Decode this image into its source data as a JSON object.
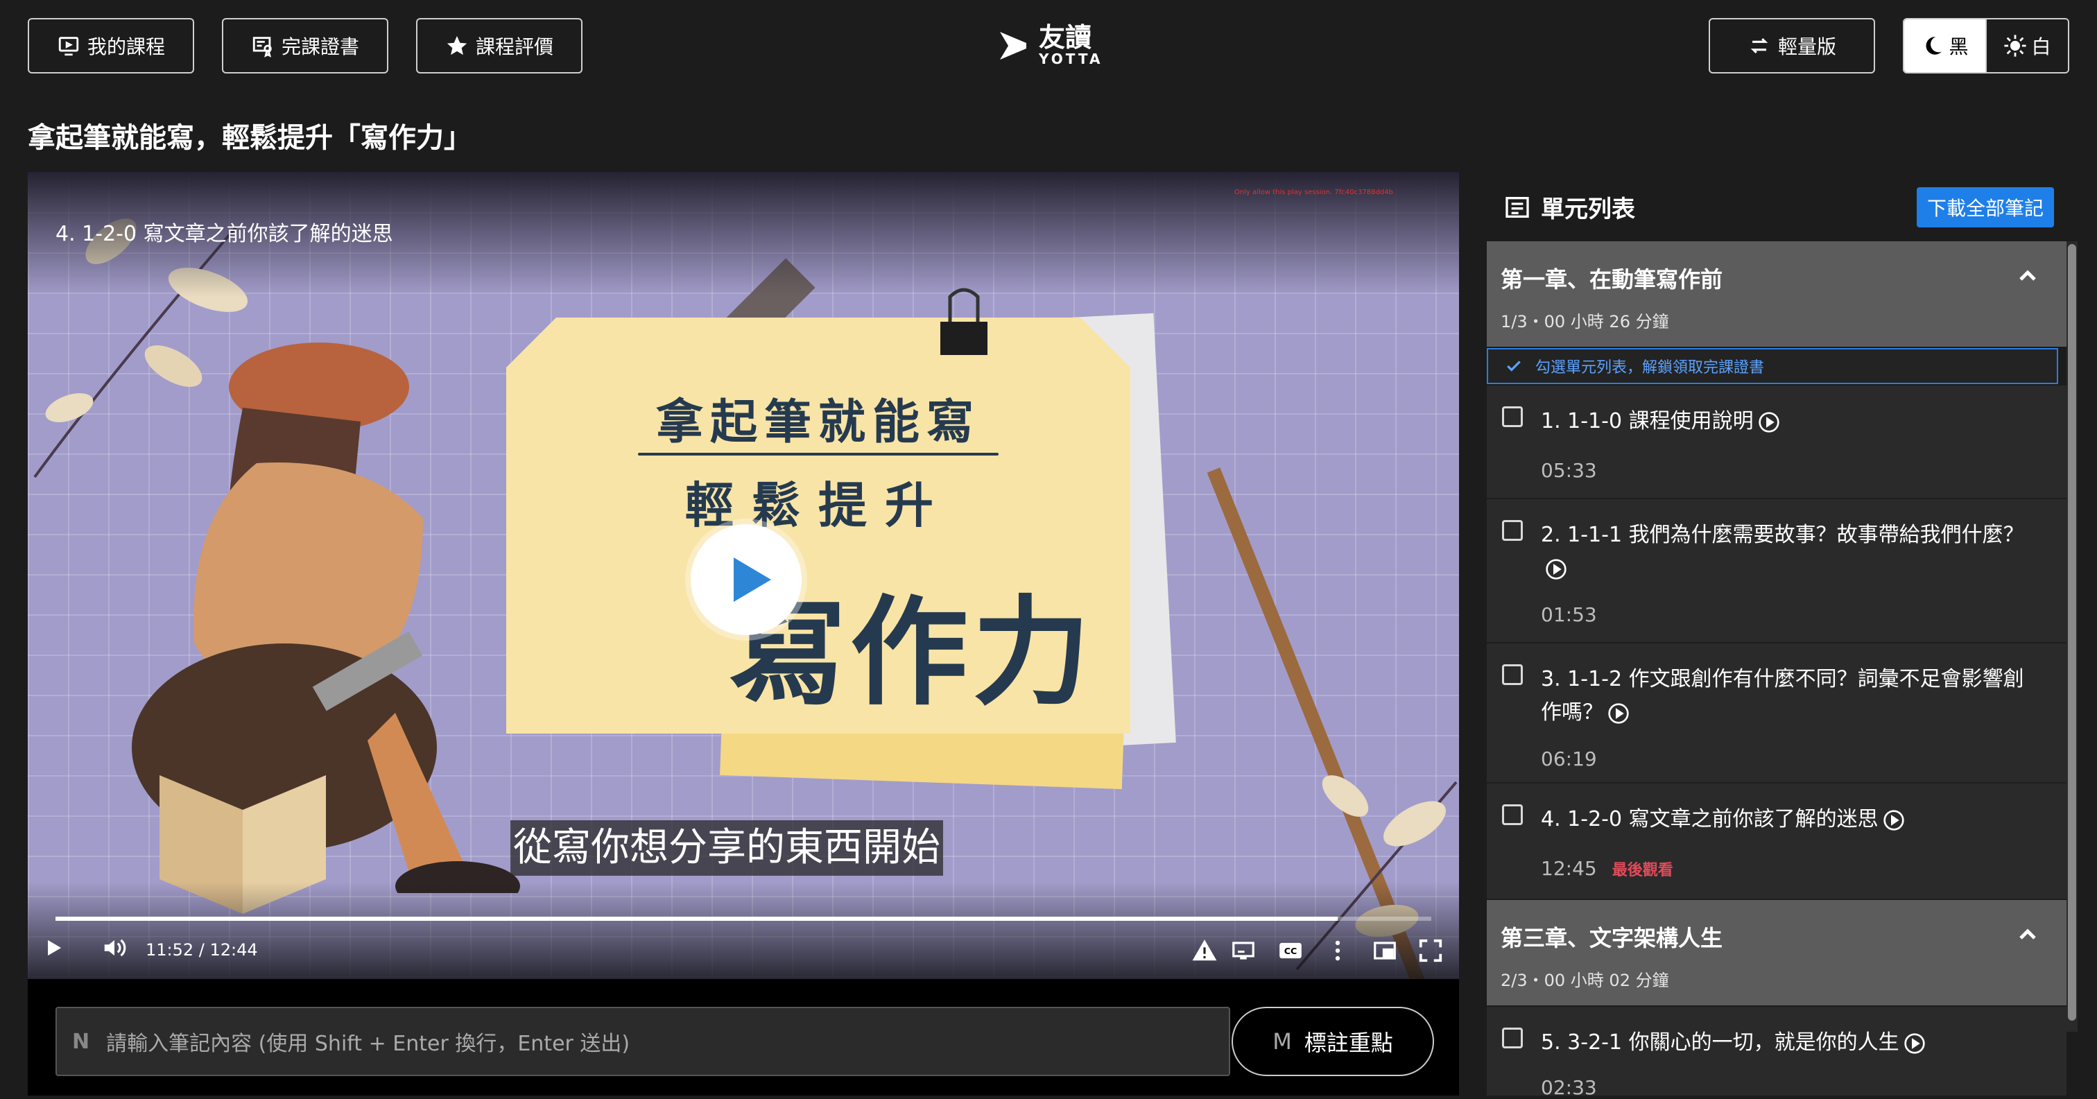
{
  "header": {
    "my_courses_label": "我的課程",
    "certificate_label": "完課證書",
    "review_label": "課程評價",
    "logo_cn": "友讀",
    "logo_en": "YOTTA",
    "lite_label": "輕量版",
    "theme_dark_label": "黑",
    "theme_light_label": "白"
  },
  "course_title": "拿起筆就能寫，輕鬆提升「寫作力」",
  "video": {
    "title": "4. 1-2-0 寫文章之前你該了解的迷思",
    "watermark": "Only allow this play session. 7fc40c3788dd4b",
    "card_line1": "拿起筆就能寫",
    "card_line2": "輕鬆提升",
    "card_line3": "寫作力",
    "subtitle": "從寫你想分享的東西開始",
    "time": "11:52 / 12:44",
    "progress": 0.932
  },
  "notes": {
    "shortcut_n": "N",
    "placeholder": "請輸入筆記內容 (使用 Shift + Enter 換行，Enter 送出)",
    "mark_shortcut": "M",
    "mark_label": "標註重點"
  },
  "sidebar": {
    "title": "單元列表",
    "download_label": "下載全部筆記",
    "hint": "勾選單元列表，解鎖領取完課證書",
    "chapters": [
      {
        "name": "第一章、在動筆寫作前",
        "meta": "1/3・00 小時 26 分鐘",
        "lessons": [
          {
            "title": "1. 1-1-0 課程使用說明",
            "duration": "05:33"
          },
          {
            "title": "2. 1-1-1 我們為什麼需要故事？故事帶給我們什麼？",
            "duration": "01:53"
          },
          {
            "title": "3. 1-1-2 作文跟創作有什麼不同？詞彙不足會影響創作嗎？",
            "duration": "06:19"
          },
          {
            "title": "4. 1-2-0 寫文章之前你該了解的迷思",
            "duration": "12:45",
            "badge": "最後觀看"
          }
        ]
      },
      {
        "name": "第三章、文字架構人生",
        "meta": "2/3・00 小時 02 分鐘",
        "lessons": [
          {
            "title": "5. 3-2-1 你關心的一切，就是你的人生",
            "duration": "02:33"
          }
        ]
      }
    ]
  },
  "colors": {
    "accent_blue": "#1f7fe8",
    "last_watched": "#e04b5a",
    "background": "#1c1c1c"
  }
}
